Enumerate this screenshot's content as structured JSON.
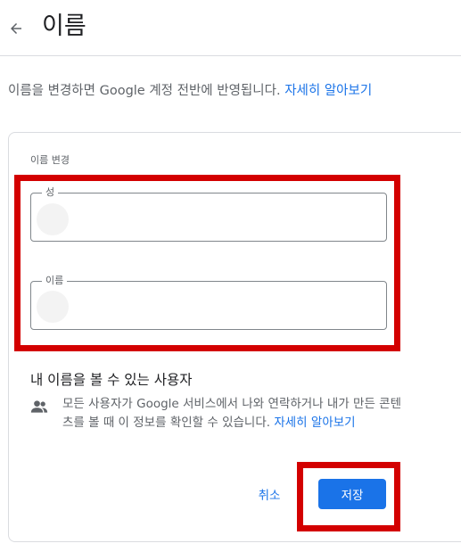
{
  "header": {
    "back_icon": "arrow-back-icon",
    "title": "이름"
  },
  "intro": {
    "text": "이름을 변경하면 Google 계정 전반에 반영됩니다. ",
    "link_label": "자세히 알아보기"
  },
  "form": {
    "section_label": "이름 변경",
    "last_name": {
      "label": "성",
      "value": ""
    },
    "first_name": {
      "label": "이름",
      "value": ""
    }
  },
  "visibility": {
    "title": "내 이름을 볼 수 있는 사용자",
    "icon": "people-icon",
    "description": "모든 사용자가 Google 서비스에서 나와 연락하거나 내가 만든 콘텐츠를 볼 때 이 정보를 확인할 수 있습니다. ",
    "link_label": "자세히 알아보기"
  },
  "actions": {
    "cancel_label": "취소",
    "save_label": "저장"
  },
  "colors": {
    "accent": "#1a73e8",
    "highlight": "#d30000"
  }
}
